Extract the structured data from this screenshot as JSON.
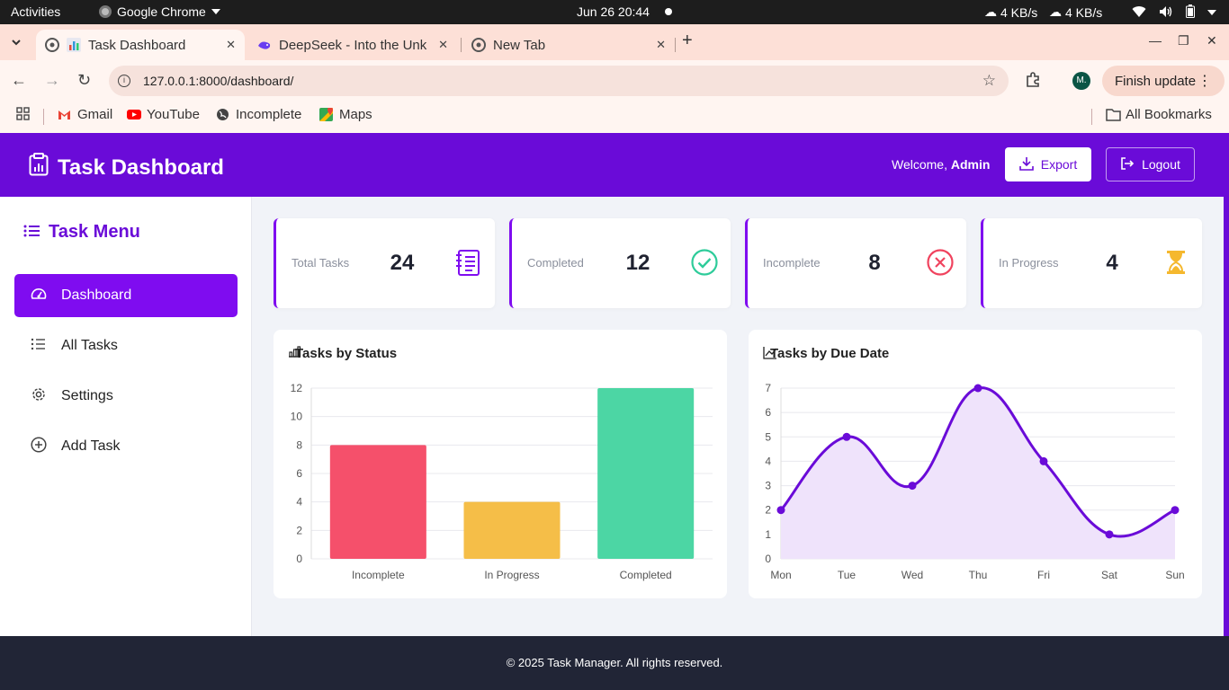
{
  "system_bar": {
    "activities": "Activities",
    "app_name": "Google Chrome",
    "clock": "Jun 26  20:44",
    "net_down": "4 KB/s",
    "net_up": "4 KB/s"
  },
  "browser": {
    "tabs": [
      {
        "title": "Task Dashboard",
        "active": true
      },
      {
        "title": "DeepSeek - Into the Unk",
        "active": false
      },
      {
        "title": "New Tab",
        "active": false
      }
    ],
    "url": "127.0.0.1:8000/dashboard/",
    "profile_initial": "M.",
    "update_label": "Finish update",
    "bookmarks": [
      "Gmail",
      "YouTube",
      "Incomplete",
      "Maps"
    ],
    "all_bookmarks": "All Bookmarks"
  },
  "header": {
    "title": "Task Dashboard",
    "welcome_prefix": "Welcome,",
    "user": "Admin",
    "export_label": "Export",
    "logout_label": "Logout"
  },
  "sidebar": {
    "title": "Task Menu",
    "items": [
      {
        "label": "Dashboard",
        "icon": "gauge-icon",
        "active": true
      },
      {
        "label": "All Tasks",
        "icon": "list-icon",
        "active": false
      },
      {
        "label": "Settings",
        "icon": "gear-icon",
        "active": false
      },
      {
        "label": "Add Task",
        "icon": "plus-circle-icon",
        "active": false
      }
    ]
  },
  "stats": [
    {
      "label": "Total Tasks",
      "value": "24",
      "icon": "clipboard-list-icon",
      "color": "#7f0cf0"
    },
    {
      "label": "Completed",
      "value": "12",
      "icon": "check-circle-icon",
      "color": "#2ecc9a"
    },
    {
      "label": "Incomplete",
      "value": "8",
      "icon": "x-circle-icon",
      "color": "#f0435e"
    },
    {
      "label": "In Progress",
      "value": "4",
      "icon": "hourglass-icon",
      "color": "#f5b82e"
    }
  ],
  "chart_titles": {
    "status": "Tasks by Status",
    "due": "Tasks by Due Date"
  },
  "chart_data": [
    {
      "type": "bar",
      "title": "Tasks by Status",
      "categories": [
        "Incomplete",
        "In Progress",
        "Completed"
      ],
      "values": [
        8,
        4,
        12
      ],
      "colors": [
        "#f5506b",
        "#f5be48",
        "#4cd6a4"
      ],
      "ylim": [
        0,
        12
      ],
      "yticks": [
        0,
        2,
        4,
        6,
        8,
        10,
        12
      ],
      "grid": true
    },
    {
      "type": "area",
      "title": "Tasks by Due Date",
      "categories": [
        "Mon",
        "Tue",
        "Wed",
        "Thu",
        "Fri",
        "Sat",
        "Sun"
      ],
      "values": [
        2,
        5,
        3,
        7,
        4,
        1,
        2
      ],
      "color": "#6a0bd8",
      "fill": "#efe3fb",
      "ylim": [
        0,
        7
      ],
      "yticks": [
        0,
        1,
        2,
        3,
        4,
        5,
        6,
        7
      ],
      "grid": true
    }
  ],
  "footer": {
    "text": "© 2025 Task Manager. All rights reserved."
  }
}
